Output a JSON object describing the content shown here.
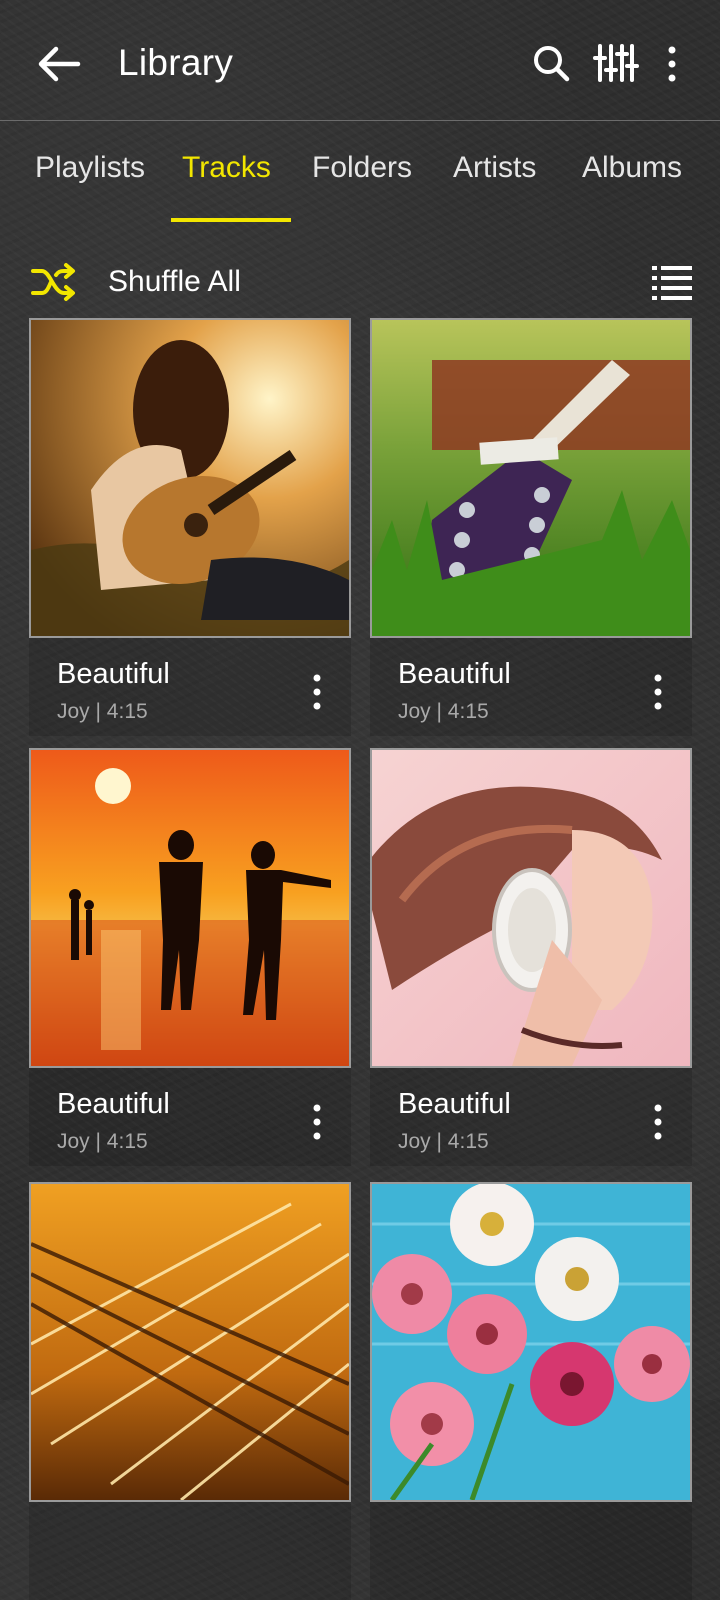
{
  "header": {
    "title": "Library",
    "back_icon": "arrow-left-icon",
    "actions": [
      "search-icon",
      "equalizer-icon",
      "more-vertical-icon"
    ]
  },
  "tabs": [
    {
      "label": "Playlists",
      "active": false
    },
    {
      "label": "Tracks",
      "active": true
    },
    {
      "label": "Folders",
      "active": false
    },
    {
      "label": "Artists",
      "active": false
    },
    {
      "label": "Albums",
      "active": false
    }
  ],
  "shuffle": {
    "label": "Shuffle All",
    "icon": "shuffle-icon",
    "view_icon": "list-view-icon"
  },
  "tracks": [
    {
      "title": "Beautiful",
      "artist": "Joy",
      "duration": "4:15",
      "meta": "Joy | 4:15",
      "art": "girl-playing-guitar"
    },
    {
      "title": "Beautiful",
      "artist": "Joy",
      "duration": "4:15",
      "meta": "Joy | 4:15",
      "art": "guitar-headstock-on-grass"
    },
    {
      "title": "Beautiful",
      "artist": "Joy",
      "duration": "4:15",
      "meta": "Joy | 4:15",
      "art": "couple-silhouette-at-sunset"
    },
    {
      "title": "Beautiful",
      "artist": "Joy",
      "duration": "4:15",
      "meta": "Joy | 4:15",
      "art": "girl-with-headphones"
    },
    {
      "title": "",
      "artist": "",
      "duration": "",
      "meta": "",
      "art": "guitar-strings-closeup"
    },
    {
      "title": "",
      "artist": "",
      "duration": "",
      "meta": "",
      "art": "pink-gerbera-flowers"
    }
  ],
  "colors": {
    "accent": "#f2e600",
    "background": "#2f2f2f",
    "text": "#ffffff",
    "secondary_text": "#a9a9a9"
  }
}
